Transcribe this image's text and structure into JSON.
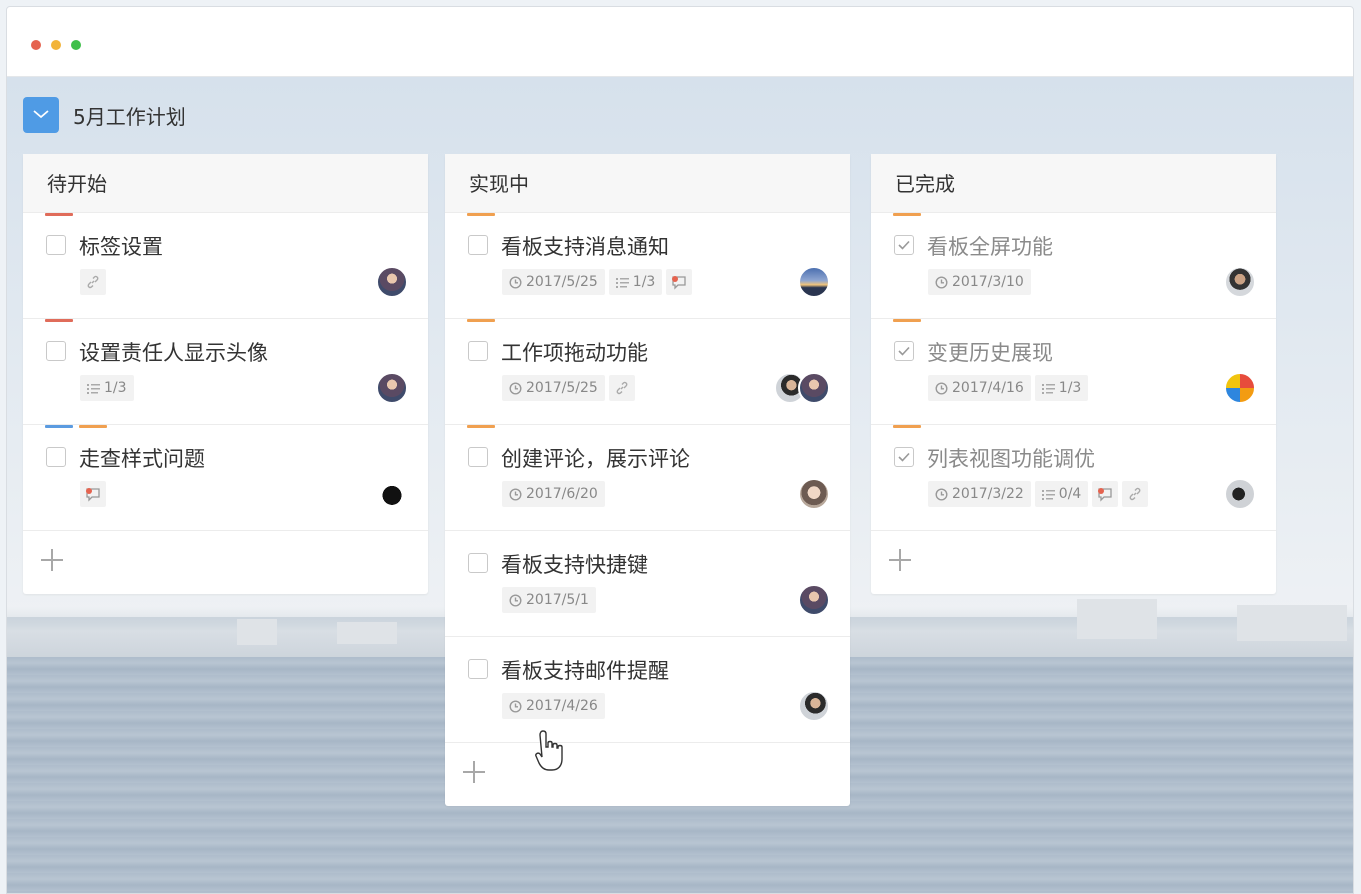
{
  "board": {
    "title": "5月工作计划",
    "icon": "board-icon"
  },
  "colors": {
    "red": "#e06c5a",
    "orange": "#f0a050",
    "blue": "#5b9be0",
    "accent": "#4f9be5",
    "titlebar_dots": [
      "#e5634f",
      "#f2b43a",
      "#3fbf4a"
    ]
  },
  "columns": [
    {
      "title": "待开始",
      "cards": [
        {
          "title": "标签设置",
          "tags": [
            "red"
          ],
          "done": false,
          "date": "",
          "checklist": "",
          "comment": false,
          "link": true,
          "avatars": [
            "avatar-woman-1"
          ]
        },
        {
          "title": "设置责任人显示头像",
          "tags": [
            "red"
          ],
          "done": false,
          "date": "",
          "checklist": "1/3",
          "comment": false,
          "link": false,
          "avatars": [
            "avatar-woman-1"
          ]
        },
        {
          "title": "走查样式问题",
          "tags": [
            "blue",
            "orange"
          ],
          "done": false,
          "date": "",
          "checklist": "",
          "comment": true,
          "link": false,
          "avatars": [
            "avatar-cat"
          ]
        }
      ],
      "add_label": "+"
    },
    {
      "title": "实现中",
      "cards": [
        {
          "title": "看板支持消息通知",
          "tags": [
            "orange"
          ],
          "done": false,
          "date": "2017/5/25",
          "checklist": "1/3",
          "comment": true,
          "link": false,
          "avatars": [
            "avatar-sunset"
          ]
        },
        {
          "title": "工作项拖动功能",
          "tags": [
            "orange"
          ],
          "done": false,
          "date": "2017/5/25",
          "checklist": "",
          "comment": false,
          "link": true,
          "avatars": [
            "avatar-man-1",
            "avatar-woman-1"
          ]
        },
        {
          "title": "创建评论，展示评论",
          "tags": [
            "orange"
          ],
          "done": false,
          "date": "2017/6/20",
          "checklist": "",
          "comment": false,
          "link": false,
          "avatars": [
            "avatar-woman-2"
          ]
        },
        {
          "title": "看板支持快捷键",
          "tags": [],
          "done": false,
          "date": "2017/5/1",
          "checklist": "",
          "comment": false,
          "link": false,
          "avatars": [
            "avatar-woman-1"
          ]
        },
        {
          "title": "看板支持邮件提醒",
          "tags": [],
          "done": false,
          "date": "2017/4/26",
          "checklist": "",
          "comment": false,
          "link": false,
          "avatars": [
            "avatar-man-1"
          ]
        }
      ],
      "add_label": "+"
    },
    {
      "title": "已完成",
      "cards": [
        {
          "title": "看板全屏功能",
          "tags": [
            "orange"
          ],
          "done": true,
          "date": "2017/3/10",
          "checklist": "",
          "comment": false,
          "link": false,
          "avatars": [
            "avatar-man-2"
          ]
        },
        {
          "title": "变更历史展现",
          "tags": [
            "orange"
          ],
          "done": true,
          "date": "2017/4/16",
          "checklist": "1/3",
          "comment": false,
          "link": false,
          "avatars": [
            "avatar-colorful"
          ]
        },
        {
          "title": "列表视图功能调优",
          "tags": [
            "orange"
          ],
          "done": true,
          "date": "2017/3/22",
          "checklist": "0/4",
          "comment": true,
          "link": true,
          "avatars": [
            "avatar-man-3"
          ]
        }
      ],
      "add_label": "+"
    }
  ]
}
